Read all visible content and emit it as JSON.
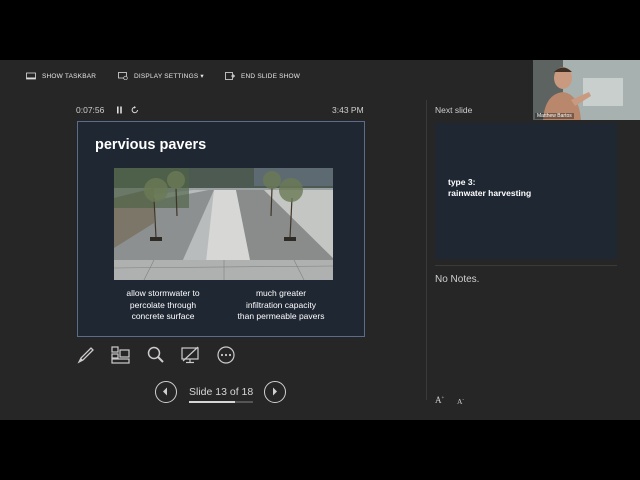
{
  "topbar": {
    "show_taskbar": "SHOW TASKBAR",
    "display_settings": "DISPLAY SETTINGS ▾",
    "end_slide_show": "END SLIDE SHOW"
  },
  "timer": "0:07:56",
  "clock": "3:43 PM",
  "slide": {
    "title": "pervious pavers",
    "caption_left": [
      "allow stormwater to",
      "percolate through",
      "concrete surface"
    ],
    "caption_right": [
      "much greater",
      "infiltration capacity",
      "than permeable pavers"
    ]
  },
  "navigation": {
    "counter": "Slide 13 of 18",
    "current": 13,
    "total": 18
  },
  "next_slide": {
    "label": "Next slide",
    "line1": "type 3:",
    "line2": "rainwater harvesting"
  },
  "notes": "No Notes.",
  "webcam": {
    "name": "Matthew Bartos"
  },
  "font_controls": [
    "A",
    "A"
  ],
  "colors": {
    "background": "#262626",
    "slide_bg": "#1f2733",
    "slide_border": "#5a6e8c"
  }
}
